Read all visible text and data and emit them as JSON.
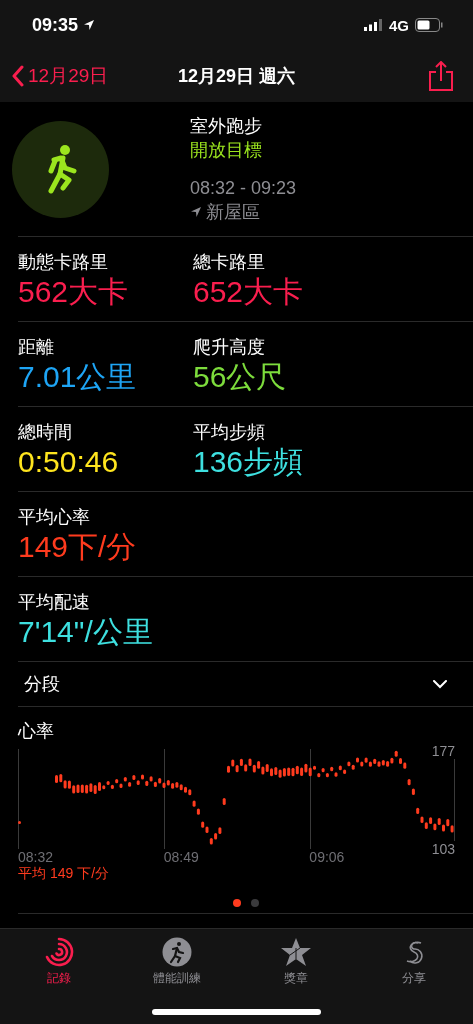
{
  "status_bar": {
    "time": "09:35",
    "network": "4G"
  },
  "nav": {
    "back_label": "12月29日",
    "title": "12月29日 週六"
  },
  "workout": {
    "type": "室外跑步",
    "goal": "開放目標",
    "time_range": "08:32 - 09:23",
    "location": "新屋區"
  },
  "stats": [
    [
      {
        "label": "動態卡路里",
        "value": "562大卡",
        "color": "#fa1e4e"
      },
      {
        "label": "總卡路里",
        "value": "652大卡",
        "color": "#fa1e4e"
      }
    ],
    [
      {
        "label": "距離",
        "value": "7.01公里",
        "color": "#1ea5f5"
      },
      {
        "label": "爬升高度",
        "value": "56公尺",
        "color": "#7ddc3c"
      }
    ],
    [
      {
        "label": "總時間",
        "value": "0:50:46",
        "color": "#ffe51e"
      },
      {
        "label": "平均步頻",
        "value": "136步頻",
        "color": "#3ee0e0"
      }
    ],
    [
      {
        "label": "平均心率",
        "value": "149下/分",
        "color": "#ff3b1e"
      }
    ],
    [
      {
        "label": "平均配速",
        "value": "7'14\"/公里",
        "color": "#3ee0e0"
      }
    ]
  ],
  "splits": {
    "label": "分段",
    "expanded": false
  },
  "heart_rate": {
    "title": "心率",
    "max_label": "177",
    "min_label": "103",
    "time_labels": [
      "08:32",
      "08:49",
      "09:06"
    ],
    "average": "平均 149 下/分",
    "pages": [
      {
        "selected": true
      },
      {
        "selected": false
      }
    ]
  },
  "tab_bar": [
    {
      "label": "記錄",
      "kind": "rings",
      "selected": true
    },
    {
      "label": "體能訓練",
      "kind": "runner",
      "selected": false
    },
    {
      "label": "獎章",
      "kind": "star",
      "selected": false
    },
    {
      "label": "分享",
      "kind": "share",
      "selected": false
    }
  ]
}
